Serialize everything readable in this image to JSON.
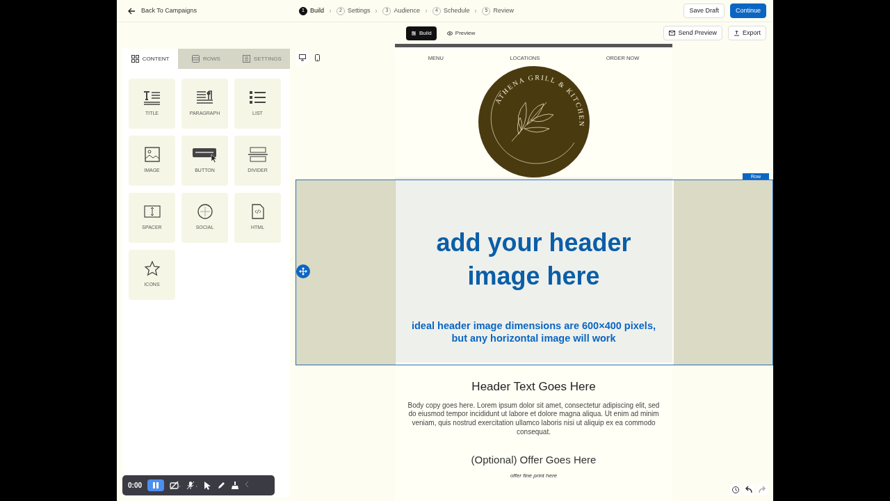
{
  "top_bar": {
    "back_link": "Back To Campaigns",
    "steps": [
      {
        "number": "1",
        "label": "Build",
        "selected": true
      },
      {
        "number": "2",
        "label": "Settings",
        "selected": false
      },
      {
        "number": "3",
        "label": "Audience",
        "selected": false
      },
      {
        "number": "4",
        "label": "Schedule",
        "selected": false
      },
      {
        "number": "5",
        "label": "Review",
        "selected": false
      }
    ],
    "buttons": [
      {
        "label": "Save Draft",
        "kind": "outline"
      },
      {
        "label": "Continue",
        "kind": "primary"
      }
    ]
  },
  "mode_toggle": [
    {
      "label": "Build",
      "selected": true
    },
    {
      "label": "Preview",
      "selected": false
    }
  ],
  "actions": [
    {
      "label": "Send Preview"
    },
    {
      "label": "Export"
    }
  ],
  "panel": {
    "tabs": [
      {
        "label": "CONTENT",
        "selected": true
      },
      {
        "label": "ROWS",
        "selected": false
      },
      {
        "label": "SETTINGS",
        "selected": false
      }
    ],
    "blocks": [
      {
        "label": "TITLE"
      },
      {
        "label": "PARAGRAPH"
      },
      {
        "label": "LIST"
      },
      {
        "label": "IMAGE"
      },
      {
        "label": "BUTTON"
      },
      {
        "label": "DIVIDER"
      },
      {
        "label": "SPACER"
      },
      {
        "label": "SOCIAL"
      },
      {
        "label": "HTML"
      },
      {
        "label": "ICONS"
      }
    ]
  },
  "devices": [
    {
      "selected": true
    },
    {
      "selected": false
    }
  ],
  "email": {
    "nav": [
      "MENU",
      "LOCATIONS",
      "ORDER NOW"
    ],
    "logo_text": "ATHENA GRILL & KITCHEN",
    "header_title": "add your header image here",
    "header_note": "ideal header image dimensions are 600×400 pixels, but any horizontal image will work",
    "heading": "Header Text Goes Here",
    "body": "Body copy goes here. Lorem ipsum dolor sit amet, consectetur adipiscing elit, sed do eiusmod tempor incididunt ut labore et dolore magna aliqua. Ut enim ad minim veniam, quis nostrud exercitation ullamco laboris nisi ut aliquip ex ea commodo consequat.",
    "offer": "(Optional) Offer Goes Here",
    "fine_print": "offer fine print here"
  },
  "row_tag": "Row",
  "recorder": {
    "time": "0:00"
  }
}
